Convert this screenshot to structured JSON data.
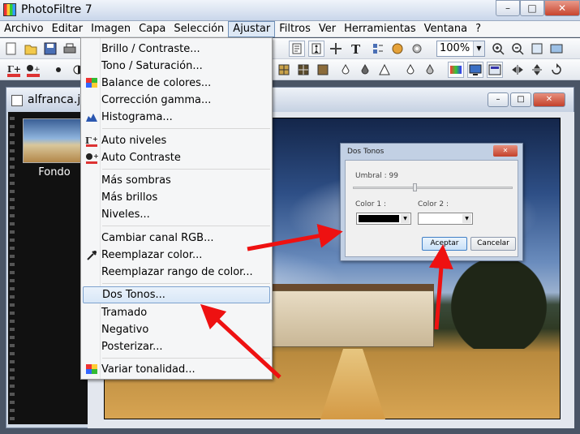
{
  "app": {
    "title": "PhotoFiltre 7"
  },
  "window_controls": {
    "minimize": "–",
    "maximize": "□",
    "close": "✕"
  },
  "menubar": {
    "items": [
      "Archivo",
      "Editar",
      "Imagen",
      "Capa",
      "Selección",
      "Ajustar",
      "Filtros",
      "Ver",
      "Herramientas",
      "Ventana",
      "?"
    ],
    "active": "Ajustar"
  },
  "toolbar": {
    "zoom_value": "100%"
  },
  "document": {
    "title": "alfranca.jp",
    "thumbnail_label": "Fondo"
  },
  "ajustar_menu": {
    "groups": [
      [
        "Brillo / Contraste...",
        "Tono / Saturación...",
        "Balance de colores...",
        "Corrección gamma...",
        "Histograma..."
      ],
      [
        "Auto niveles",
        "Auto Contraste"
      ],
      [
        "Más sombras",
        "Más brillos",
        "Niveles..."
      ],
      [
        "Cambiar canal RGB...",
        "Reemplazar color...",
        "Reemplazar rango de color..."
      ],
      [
        "Dos Tonos...",
        "Tramado",
        "Negativo",
        "Posterizar..."
      ],
      [
        "Variar tonalidad..."
      ]
    ],
    "highlighted": "Dos Tonos..."
  },
  "dialog": {
    "title": "Dos Tonos",
    "umbral_label": "Umbral : 99",
    "umbral_value": 99,
    "color1_label": "Color 1 :",
    "color2_label": "Color 2 :",
    "color1": "#000000",
    "color2": "#ffffff",
    "accept_label": "Aceptar",
    "cancel_label": "Cancelar"
  },
  "colors": {
    "annotation_arrows": "#ee1111",
    "menu_highlight": "#d8e7f7"
  }
}
